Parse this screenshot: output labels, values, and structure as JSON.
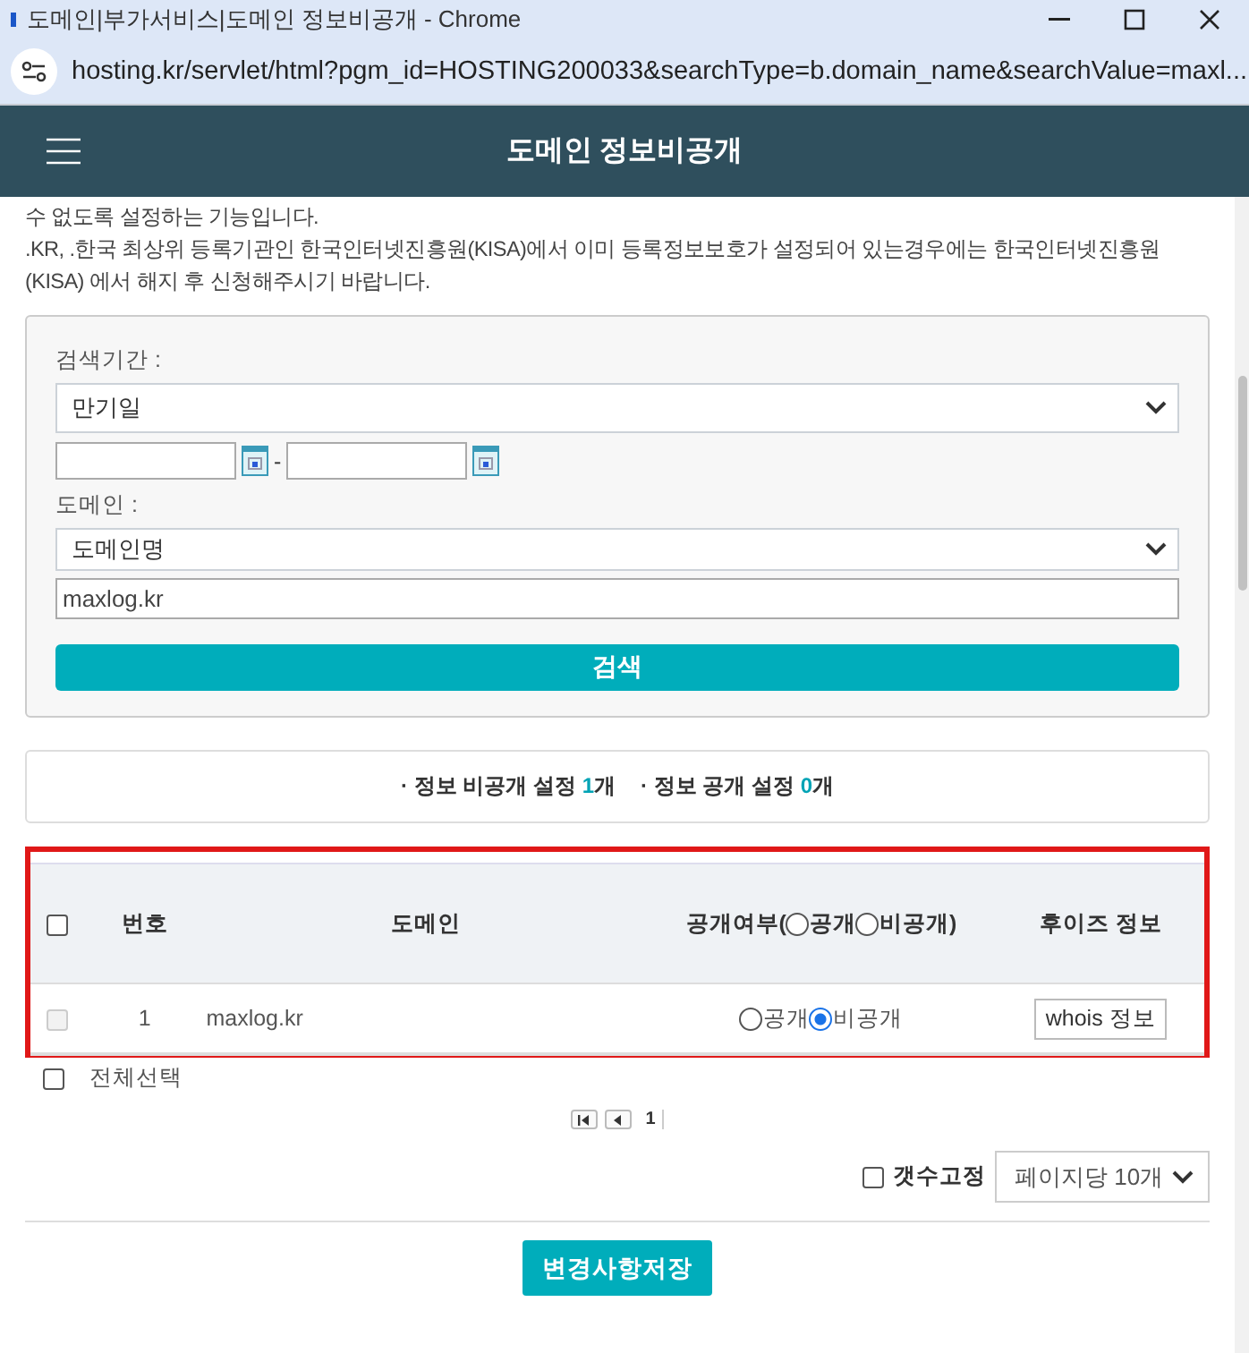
{
  "browser": {
    "title": "도메인|부가서비스|도메인 정보비공개 - Chrome",
    "url": "hosting.kr/servlet/html?pgm_id=HOSTING200033&searchType=b.domain_name&searchValue=maxl..."
  },
  "header": {
    "title": "도메인 정보비공개"
  },
  "description": [
    "수 없도록 설정하는 기능입니다.",
    ".KR, .한국 최상위 등록기관인 한국인터넷진흥원(KISA)에서 이미 등록정보보호가 설정되어 있는경우에는 한국인터넷진흥원(KISA) 에서 해지 후 신청해주시기 바랍니다."
  ],
  "search": {
    "period_label": "검색기간 :",
    "period_select": "만기일",
    "date_separator": "-",
    "domain_label": "도메인 :",
    "domain_select": "도메인명",
    "domain_value": "maxlog.kr",
    "button": "검색"
  },
  "summary": [
    {
      "label": "· 정보 비공개 설정",
      "count": "1",
      "unit": "개"
    },
    {
      "label": "· 정보 공개 설정",
      "count": "0",
      "unit": "개"
    }
  ],
  "table": {
    "header_checked": false,
    "number_column": "번호",
    "domain_column": "도메인",
    "visibility_column": {
      "label": "공개여부(",
      "options": [
        {
          "label": "공개",
          "selected": false
        },
        {
          "label": "비공개",
          "selected": false
        }
      ],
      "close": ")"
    },
    "whois_column": "후이즈 정보",
    "rows": [
      {
        "checked": false,
        "disabled": true,
        "number": "1",
        "domain": "maxlog.kr",
        "options": [
          {
            "label": "공개",
            "selected": false
          },
          {
            "label": "비공개",
            "selected": true
          }
        ],
        "whois_button": "whois 정보"
      }
    ]
  },
  "select_all": {
    "label": "전체선택",
    "checked": false
  },
  "pagination": {
    "pages": [
      {
        "label": "1",
        "selected": true
      }
    ]
  },
  "fix_count": {
    "label": "갯수고정",
    "checked": false
  },
  "page_size": "페이지당 10개",
  "save_button": "변경사항저장"
}
